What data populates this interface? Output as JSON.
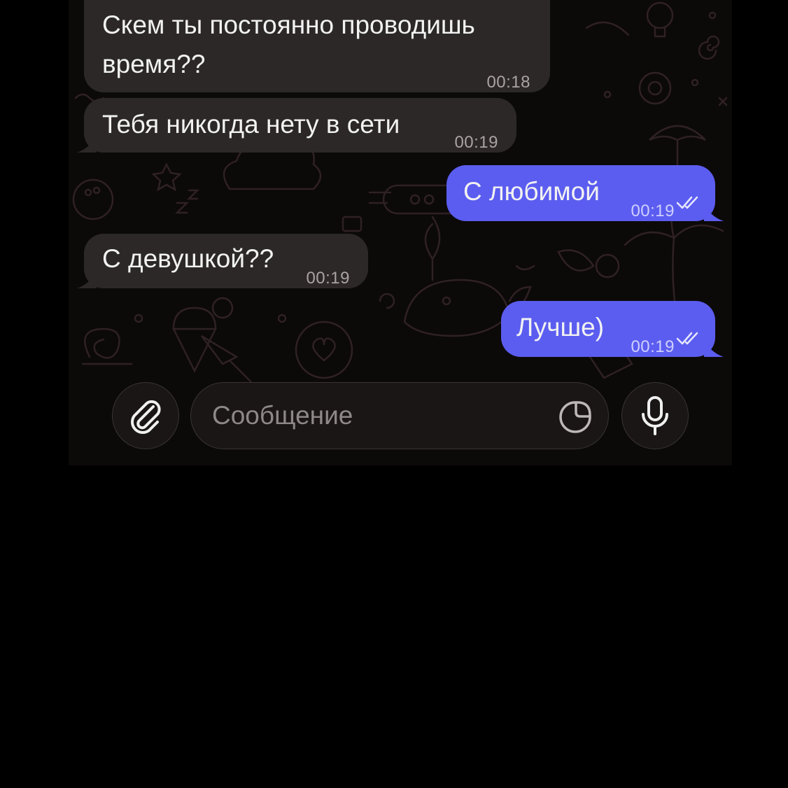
{
  "messages": [
    {
      "direction": "incoming",
      "line1": "Скем ты постоянно проводишь",
      "line2": "время??",
      "time": "00:18"
    },
    {
      "direction": "incoming",
      "text": "Тебя никогда нету в сети",
      "time": "00:19"
    },
    {
      "direction": "outgoing",
      "text": "С любимой",
      "time": "00:19",
      "status": "read"
    },
    {
      "direction": "incoming",
      "text": "С девушкой??",
      "time": "00:19"
    },
    {
      "direction": "outgoing",
      "text": "Лучше)",
      "time": "00:19",
      "status": "read"
    }
  ],
  "composer": {
    "placeholder": "Сообщение",
    "attach_icon": "paperclip-icon",
    "sticker_icon": "sticker-icon",
    "mic_icon": "microphone-icon"
  },
  "colors": {
    "incoming_bubble": "#2d2828",
    "outgoing_bubble": "#5b5df0",
    "background": "#0c0909",
    "doodle": "#2e1f22"
  }
}
